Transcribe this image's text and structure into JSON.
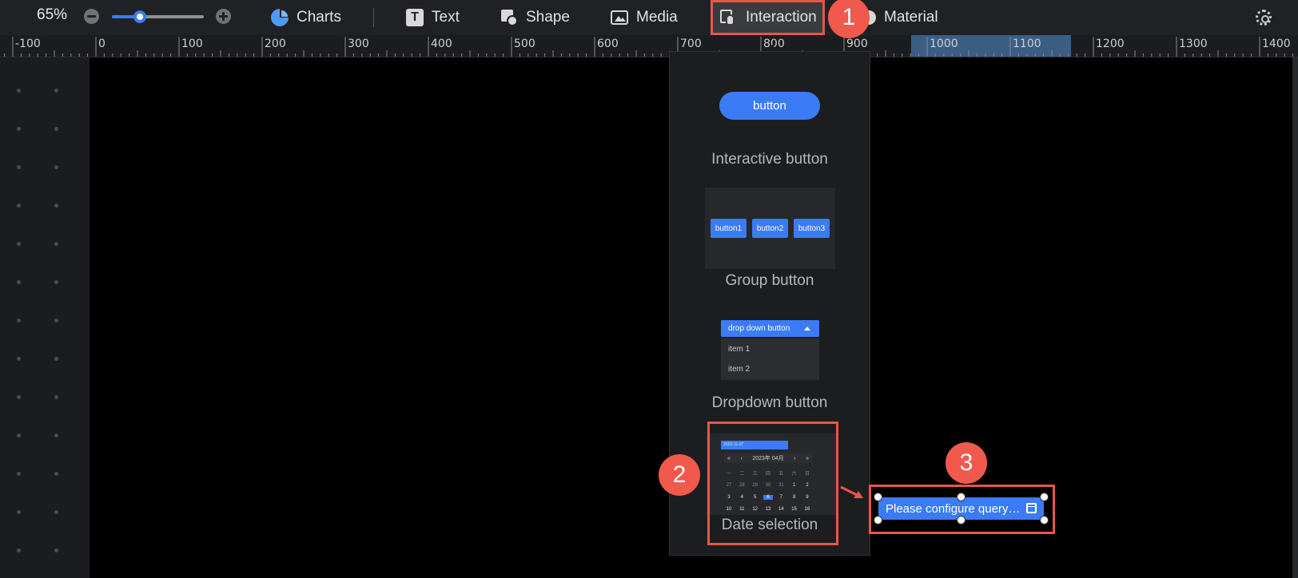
{
  "toolbar": {
    "zoom": {
      "label": "65%",
      "value_percent": 65
    },
    "items": [
      {
        "label": "Charts",
        "icon": "pie-chart-icon"
      },
      {
        "label": "Text",
        "icon": "text-icon"
      },
      {
        "label": "Shape",
        "icon": "shape-icon"
      },
      {
        "label": "Media",
        "icon": "image-icon"
      },
      {
        "label": "Interaction",
        "icon": "pointer-hand-icon",
        "active": true
      },
      {
        "label": "Material",
        "icon": "material-icon"
      }
    ],
    "settings_icon": "gear-icon"
  },
  "ruler": {
    "labels": [
      "-100",
      "0",
      "100",
      "200",
      "300",
      "400",
      "500",
      "600",
      "700",
      "800",
      "900",
      "1000",
      "1100",
      "1200",
      "1300",
      "1400"
    ],
    "highlight_range": [
      1000,
      1200
    ]
  },
  "interaction_panel": {
    "components": [
      {
        "label": "Interactive button",
        "preview_text": "button"
      },
      {
        "label": "Group button",
        "preview_buttons": [
          "button1",
          "button2",
          "button3"
        ]
      },
      {
        "label": "Dropdown button",
        "preview_head": "drop down button",
        "preview_items": [
          "item 1",
          "item 2"
        ]
      },
      {
        "label": "Date selection",
        "preview_input": "2023-11-07",
        "preview_nav": {
          "prev_year": "«",
          "prev_month": "‹",
          "title": "2023年 04月",
          "next_month": "›",
          "next_year": "»"
        },
        "preview_weekdays": [
          "一",
          "二",
          "三",
          "四",
          "五",
          "六",
          "日"
        ],
        "preview_days": [
          [
            "27",
            "28",
            "29",
            "30",
            "31",
            "1",
            "2"
          ],
          [
            "3",
            "4",
            "5",
            "6",
            "7",
            "8",
            "9"
          ],
          [
            "10",
            "11",
            "12",
            "13",
            "14",
            "15",
            "16"
          ]
        ],
        "preview_selected_day": "6"
      }
    ]
  },
  "canvas": {
    "widget": {
      "text": "Please configure query…",
      "icon": "calendar-icon"
    }
  },
  "callouts": [
    "1",
    "2",
    "3"
  ],
  "colors": {
    "accent": "#3b7bf5",
    "callout": "#f0594c",
    "toolbar_bg": "#1f2124",
    "canvas_bg": "#000000"
  }
}
